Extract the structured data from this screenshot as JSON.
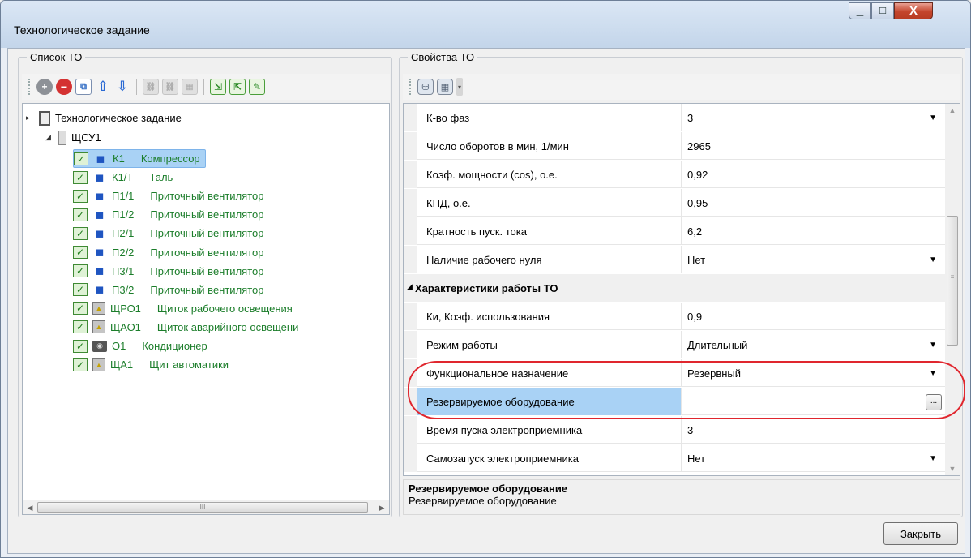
{
  "window": {
    "title": "Технологическое задание",
    "controls": {
      "min": "▁",
      "max": "☐",
      "close": "X"
    }
  },
  "left_group": {
    "caption": "Список ТО",
    "tree": {
      "root": "Технологическое задание",
      "node": "ЩСУ1",
      "items": [
        {
          "code": "К1",
          "name": "Компрессор",
          "icon": "motor-icon",
          "selected": true
        },
        {
          "code": "К1/Т",
          "name": "Таль",
          "icon": "motor-icon"
        },
        {
          "code": "П1/1",
          "name": "Приточный вентилятор",
          "icon": "motor-icon"
        },
        {
          "code": "П1/2",
          "name": "Приточный вентилятор",
          "icon": "motor-icon"
        },
        {
          "code": "П2/1",
          "name": "Приточный вентилятор",
          "icon": "motor-icon"
        },
        {
          "code": "П2/2",
          "name": "Приточный вентилятор",
          "icon": "motor-icon"
        },
        {
          "code": "П3/1",
          "name": "Приточный вентилятор",
          "icon": "motor-icon"
        },
        {
          "code": "П3/2",
          "name": "Приточный вентилятор",
          "icon": "motor-icon"
        },
        {
          "code": "ЩРО1",
          "name": "Щиток рабочего освещения",
          "icon": "panel-icon"
        },
        {
          "code": "ЩАО1",
          "name": "Щиток аварийного освещени",
          "icon": "panel-icon"
        },
        {
          "code": "О1",
          "name": "Кондиционер",
          "icon": "ac-icon"
        },
        {
          "code": "ЩА1",
          "name": "Щит автоматики",
          "icon": "panel-icon"
        }
      ],
      "scroll_thumb": "III"
    }
  },
  "right_group": {
    "caption": "Свойства ТО",
    "rows": [
      {
        "name": "К-во фаз",
        "value": "3",
        "dropdown": true
      },
      {
        "name": "Число оборотов в мин, 1/мин",
        "value": "2965"
      },
      {
        "name": "Коэф. мощности (cos), о.е.",
        "value": "0,92"
      },
      {
        "name": "КПД, о.е.",
        "value": "0,95"
      },
      {
        "name": "Кратность пуск. тока",
        "value": "6,2"
      },
      {
        "name": "Наличие рабочего нуля",
        "value": "Нет",
        "dropdown": true
      },
      {
        "category": true,
        "name": "Характеристики работы ТО"
      },
      {
        "name": "Ки, Коэф. использования",
        "value": "0,9"
      },
      {
        "name": "Режим работы",
        "value": "Длительный",
        "dropdown": true
      },
      {
        "name": "Функциональное назначение",
        "value": "Резервный",
        "dropdown": true
      },
      {
        "name": "Резервируемое оборудование",
        "value": "",
        "selected": true,
        "ellipsis": "..."
      },
      {
        "name": "Время пуска электроприемника",
        "value": "3"
      },
      {
        "name": "Самозапуск электроприемника",
        "value": "Нет",
        "dropdown": true
      }
    ],
    "description": {
      "title": "Резервируемое оборудование",
      "text": "Резервируемое оборудование"
    },
    "scroll_grip": "≡"
  },
  "buttons": {
    "close": "Закрыть"
  },
  "colors": {
    "highlight": "#a9d2f5",
    "annotation": "#e0262e",
    "item_text": "#1b7d2a"
  }
}
